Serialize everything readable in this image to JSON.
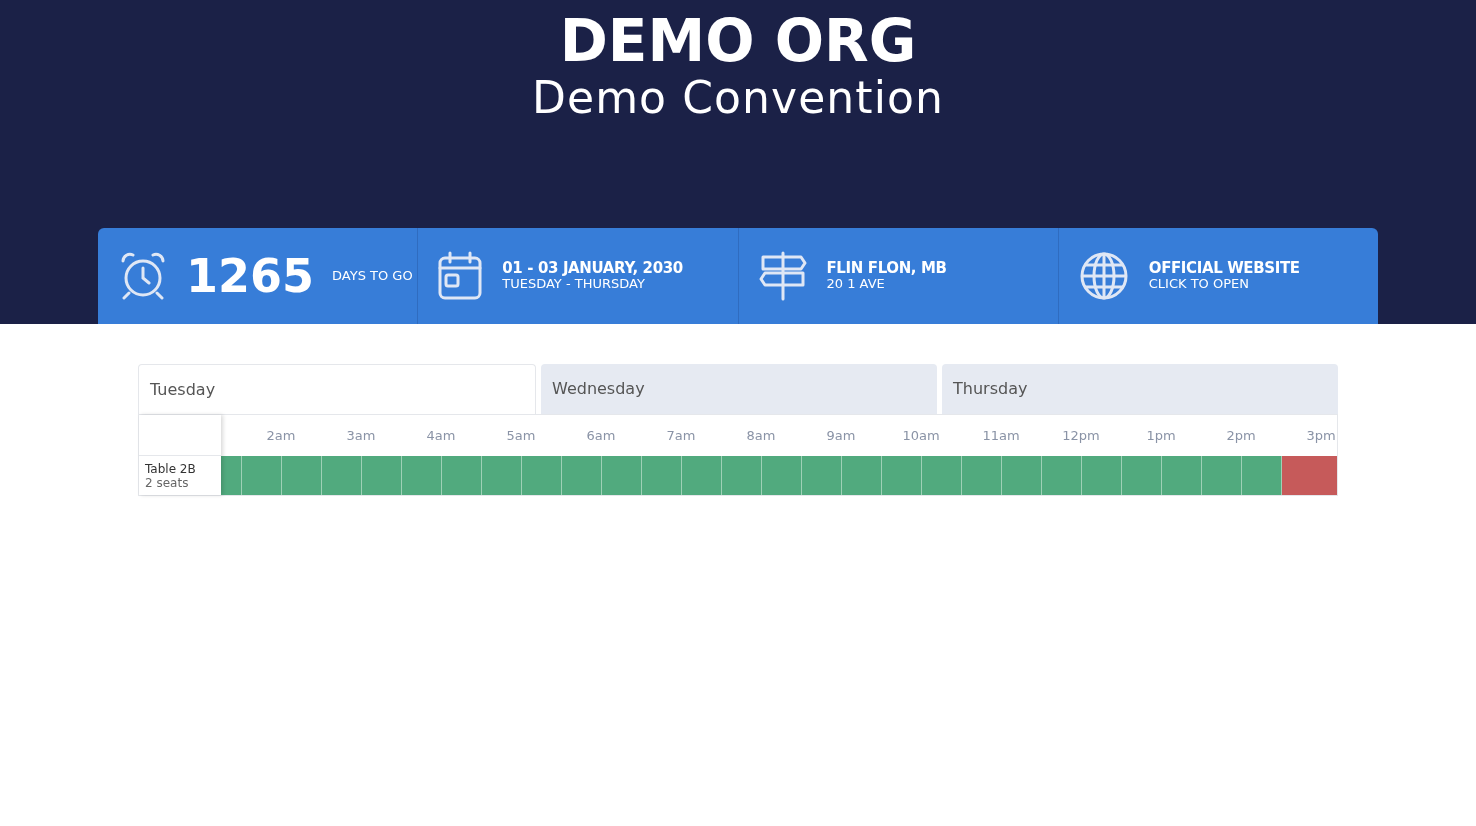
{
  "header": {
    "org": "DEMO ORG",
    "event": "Demo Convention"
  },
  "info": [
    {
      "kind": "countdown",
      "value": "1265",
      "label": "DAYS TO GO"
    },
    {
      "kind": "date",
      "title": "01 - 03 JANUARY, 2030",
      "subtitle": "TUESDAY - THURSDAY"
    },
    {
      "kind": "location",
      "title": "FLIN FLON, MB",
      "subtitle": "20 1 AVE"
    },
    {
      "kind": "website",
      "title": "OFFICIAL WEBSITE",
      "subtitle": "CLICK TO OPEN"
    }
  ],
  "tabs": [
    {
      "label": "Tuesday",
      "selected": true
    },
    {
      "label": "Wednesday",
      "selected": false
    },
    {
      "label": "Thursday",
      "selected": false
    }
  ],
  "hours": [
    "2am",
    "3am",
    "4am",
    "5am",
    "6am",
    "7am",
    "8am",
    "9am",
    "10am",
    "11am",
    "12pm",
    "1pm",
    "2pm",
    "3pm"
  ],
  "rows": [
    {
      "name": "Table 2B",
      "seats": "2 seats",
      "slots": [
        {
          "booked": false
        },
        {
          "booked": false
        },
        {
          "booked": false
        },
        {
          "booked": false
        },
        {
          "booked": false
        },
        {
          "booked": false
        },
        {
          "booked": false
        },
        {
          "booked": false
        },
        {
          "booked": false
        },
        {
          "booked": false
        },
        {
          "booked": false
        },
        {
          "booked": false
        },
        {
          "booked": false
        },
        {
          "booked": false
        },
        {
          "booked": false
        },
        {
          "booked": false
        },
        {
          "booked": false
        },
        {
          "booked": false
        },
        {
          "booked": false
        },
        {
          "booked": false
        },
        {
          "booked": false
        },
        {
          "booked": false
        },
        {
          "booked": false
        },
        {
          "booked": false
        },
        {
          "booked": false
        },
        {
          "booked": false
        },
        {
          "booked": false
        },
        {
          "booked": true
        }
      ]
    }
  ]
}
